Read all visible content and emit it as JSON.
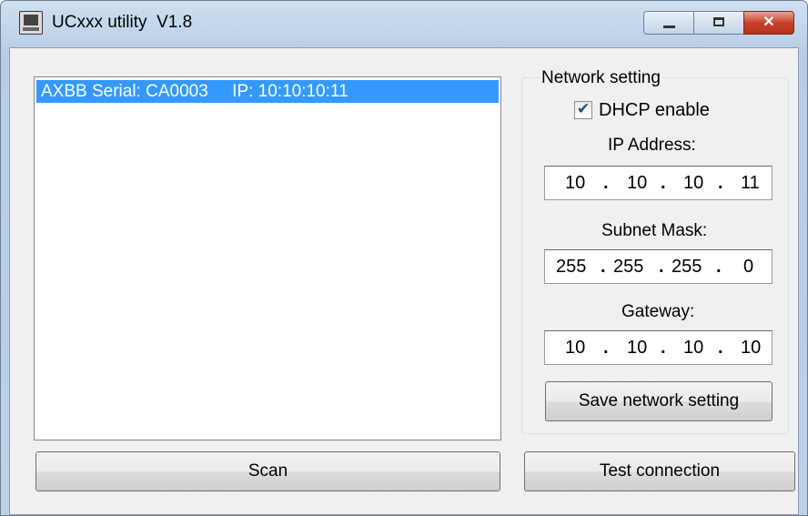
{
  "window": {
    "title": "UCxxx utility  V1.8",
    "minimize_label": "",
    "maximize_label": "",
    "close_label": "✕"
  },
  "device_list": {
    "items": [
      {
        "label": "AXBB Serial: CA0003     IP: 10:10:10:11",
        "selected": true
      }
    ]
  },
  "network": {
    "group_title": "Network setting",
    "dhcp": {
      "label": "DHCP enable",
      "checked": true
    },
    "ip_address": {
      "label": "IP Address:",
      "octets": [
        "10",
        "10",
        "10",
        "11"
      ]
    },
    "subnet_mask": {
      "label": "Subnet Mask:",
      "octets": [
        "255",
        "255",
        "255",
        "0"
      ]
    },
    "gateway": {
      "label": "Gateway:",
      "octets": [
        "10",
        "10",
        "10",
        "10"
      ]
    },
    "save_label": "Save network setting"
  },
  "actions": {
    "scan_label": "Scan",
    "test_label": "Test connection"
  },
  "colors": {
    "selection": "#3399ff",
    "close_button": "#c9412d",
    "client_bg": "#f0f0f0"
  }
}
